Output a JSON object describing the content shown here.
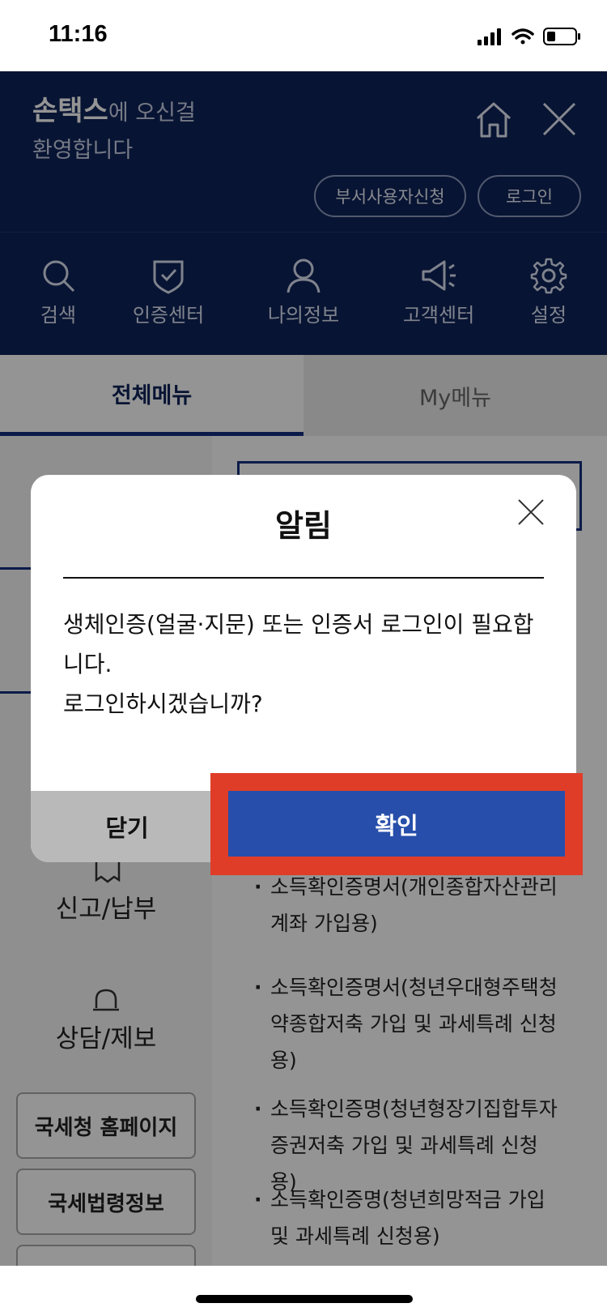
{
  "status": {
    "time": "11:16"
  },
  "header": {
    "brand": "손택스",
    "welcome_rest_line1": "에 오신걸",
    "welcome_line2": "환영합니다",
    "dept_user_button": "부서사용자신청",
    "login_button": "로그인"
  },
  "quick_menu": [
    {
      "label": "검색",
      "icon": "search-icon"
    },
    {
      "label": "인증센터",
      "icon": "shield-check-icon"
    },
    {
      "label": "나의정보",
      "icon": "user-icon"
    },
    {
      "label": "고객센터",
      "icon": "megaphone-icon"
    },
    {
      "label": "설정",
      "icon": "gear-icon"
    }
  ],
  "tabs": {
    "all": "전체메뉴",
    "my": "My메뉴"
  },
  "sidebar": {
    "items": [
      "신고/납부",
      "상담/제보"
    ],
    "buttons": [
      "국세청 홈페이지",
      "국세법령정보"
    ]
  },
  "menu_list": [
    "소득확인증명서(개인종합자산관리계좌 가입용)",
    "소득확인증명서(청년우대형주택청약종합저축 가입 및 과세특례 신청용)",
    "소득확인증명(청년형장기집합투자증권저축 가입 및 과세특례 신청용)",
    "소득확인증명(청년희망적금 가입 및 과세특례 신청용)"
  ],
  "dialog": {
    "title": "알림",
    "message_line1": "생체인증(얼굴·지문) 또는 인증서 로그인이 필요합",
    "message_line2": "니다.",
    "message_line3": "로그인하시겠습니까?",
    "close_button": "닫기",
    "confirm_button": "확인"
  },
  "colors": {
    "header_navy": "#0e2359",
    "confirm_blue": "#274eaa",
    "highlight_red": "#e03d29"
  }
}
